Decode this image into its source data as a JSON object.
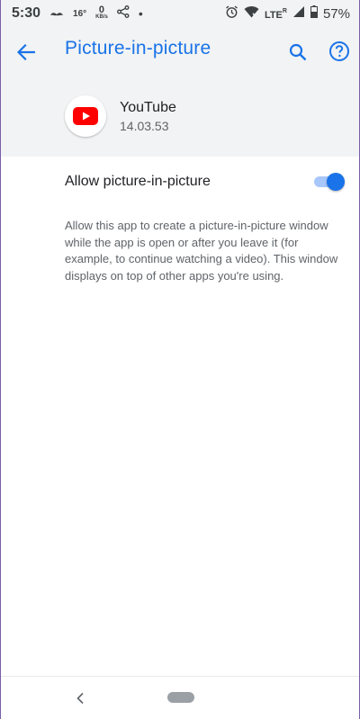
{
  "status_bar": {
    "time": "5:30",
    "temperature": "16°",
    "data_rate_value": "0",
    "data_rate_unit": "KB/s",
    "network": "LTE",
    "roaming": "R",
    "battery": "57%",
    "icons": [
      "mustache-icon",
      "share-icon",
      "dot-icon",
      "alarm-icon",
      "wifi-icon",
      "signal-icon",
      "battery-icon"
    ]
  },
  "app_bar": {
    "title": "Picture-in-picture",
    "icons": [
      "back-arrow-icon",
      "search-icon",
      "help-icon"
    ]
  },
  "app": {
    "name": "YouTube",
    "version": "14.03.53"
  },
  "setting": {
    "label": "Allow picture-in-picture",
    "enabled": true,
    "description": "Allow this app to create a picture-in-picture window while the app is open or after you leave it (for example, to continue watching a video). This window displays on top of other apps you're using."
  },
  "colors": {
    "accent": "#1a73e8",
    "toggle_track": "#a8c7fa",
    "youtube_red": "#ff0000",
    "header_bg": "#f1f3f4"
  }
}
